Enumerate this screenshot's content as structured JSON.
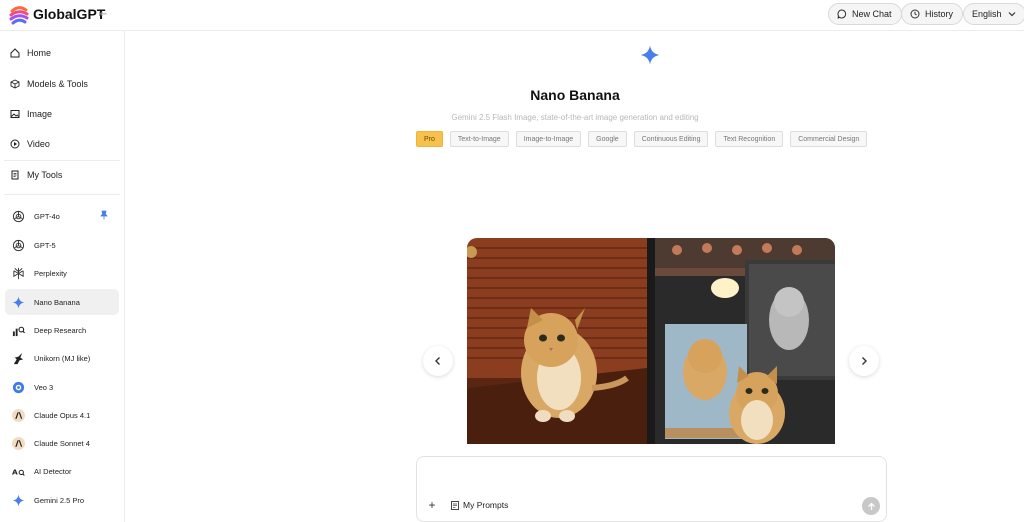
{
  "header": {
    "logo_text": "GlobalGPT",
    "new_chat_label": "New Chat",
    "history_label": "History",
    "language_label": "English"
  },
  "sidebar": {
    "nav": [
      {
        "label": "Home",
        "icon": "home-icon"
      },
      {
        "label": "Models & Tools",
        "icon": "cube-icon"
      },
      {
        "label": "Image",
        "icon": "image-icon"
      },
      {
        "label": "Video",
        "icon": "play-circle-icon"
      },
      {
        "label": "My Tools",
        "icon": "document-icon"
      }
    ],
    "tools": [
      {
        "label": "GPT-4o",
        "icon": "openai-icon",
        "pinned": true
      },
      {
        "label": "GPT-5",
        "icon": "openai-icon"
      },
      {
        "label": "Perplexity",
        "icon": "perplexity-icon"
      },
      {
        "label": "Nano Banana",
        "icon": "gemini-star-icon",
        "active": true
      },
      {
        "label": "Deep Research",
        "icon": "deep-research-icon"
      },
      {
        "label": "Unikorn (MJ like)",
        "icon": "unicorn-icon"
      },
      {
        "label": "Veo 3",
        "icon": "veo-icon"
      },
      {
        "label": "Claude Opus 4.1",
        "icon": "anthropic-icon"
      },
      {
        "label": "Claude Sonnet 4",
        "icon": "anthropic-icon"
      },
      {
        "label": "AI Detector",
        "icon": "ai-detector-icon"
      },
      {
        "label": "Gemini 2.5 Pro",
        "icon": "gemini-star-icon"
      }
    ]
  },
  "main": {
    "title": "Nano Banana",
    "subtitle": "Gemini 2.5 Flash Image, state-of-the-art image generation and editing",
    "tags": [
      "Pro",
      "Text-to-Image",
      "Image-to-Image",
      "Google",
      "Continuous Editing",
      "Text Recognition",
      "Commercial Design"
    ],
    "composer": {
      "placeholder": "",
      "prompts_label": "My Prompts"
    }
  },
  "colors": {
    "accent": "#f6c14d",
    "gemini_blue": "#4a7ee8"
  }
}
